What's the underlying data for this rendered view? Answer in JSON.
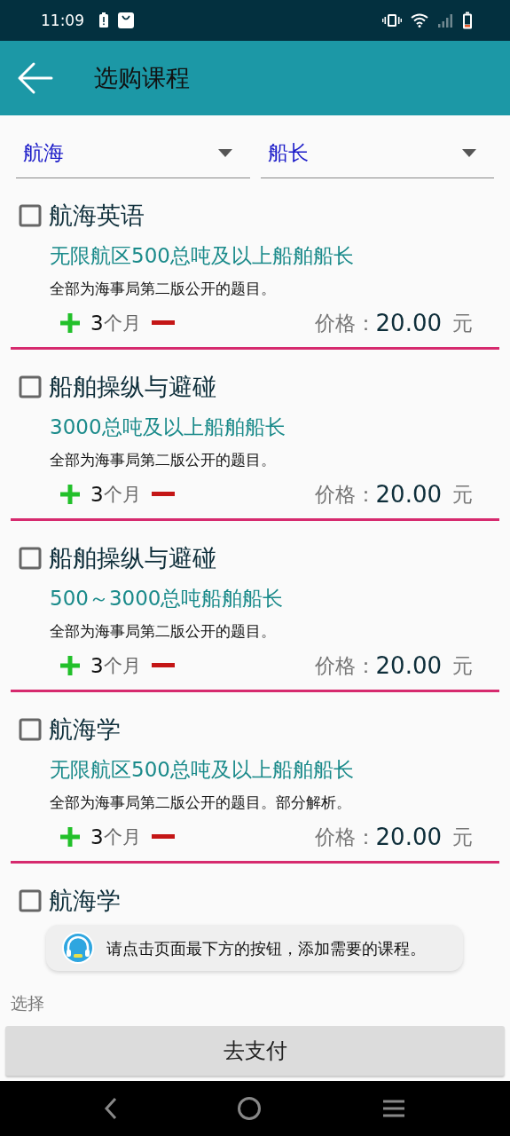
{
  "status_bar": {
    "time": "11:09"
  },
  "header": {
    "title": "选购课程"
  },
  "filters": [
    {
      "value": "航海"
    },
    {
      "value": "船长"
    }
  ],
  "courses": [
    {
      "name": "航海英语",
      "checked": false,
      "position": "无限航区500总吨及以上船舶船长",
      "description": "全部为海事局第二版公开的题目。",
      "duration_value": "3",
      "duration_unit": "个月",
      "price_label": "价格：",
      "price": "20.00",
      "currency": "元"
    },
    {
      "name": "船舶操纵与避碰",
      "checked": false,
      "position": "3000总吨及以上船舶船长",
      "description": "全部为海事局第二版公开的题目。",
      "duration_value": "3",
      "duration_unit": "个月",
      "price_label": "价格：",
      "price": "20.00",
      "currency": "元"
    },
    {
      "name": "船舶操纵与避碰",
      "checked": false,
      "position": "500～3000总吨船舶船长",
      "description": "全部为海事局第二版公开的题目。",
      "duration_value": "3",
      "duration_unit": "个月",
      "price_label": "价格：",
      "price": "20.00",
      "currency": "元"
    },
    {
      "name": "航海学",
      "checked": false,
      "position": "无限航区500总吨及以上船舶船长",
      "description": "全部为海事局第二版公开的题目。部分解析。",
      "duration_value": "3",
      "duration_unit": "个月",
      "price_label": "价格：",
      "price": "20.00",
      "currency": "元"
    },
    {
      "name": "航海学",
      "checked": false
    }
  ],
  "toast": {
    "message": "请点击页面最下方的按钮，添加需要的课程。"
  },
  "summary": {
    "label": "选择"
  },
  "pay_button": {
    "label": "去支付"
  }
}
